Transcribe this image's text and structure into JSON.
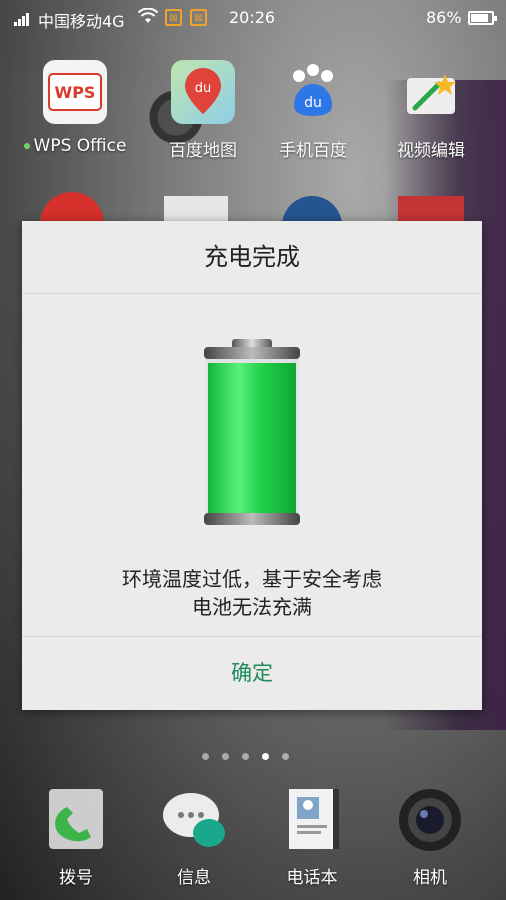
{
  "status_bar": {
    "carrier": "中国移动4G",
    "time": "20:26",
    "battery_percent": "86%",
    "battery_level": 0.86
  },
  "apps": [
    {
      "label": "WPS Office",
      "icon": "wps-office-icon",
      "has_dot": true
    },
    {
      "label": "百度地图",
      "icon": "baidu-map-icon"
    },
    {
      "label": "手机百度",
      "icon": "mobile-baidu-icon"
    },
    {
      "label": "视频编辑",
      "icon": "video-editor-icon"
    }
  ],
  "dialog": {
    "title": "充电完成",
    "message_line1": "环境温度过低，基于安全考虑",
    "message_line2": "电池无法充满",
    "ok_label": "确定",
    "battery_fill_level": 1.0,
    "accent_color": "#1e8a5c",
    "battery_color": "#22d14a"
  },
  "page_indicator": {
    "count": 5,
    "active": 3
  },
  "dock": [
    {
      "label": "拨号",
      "icon": "phone-dialer-icon"
    },
    {
      "label": "信息",
      "icon": "messages-icon"
    },
    {
      "label": "电话本",
      "icon": "contacts-icon"
    },
    {
      "label": "相机",
      "icon": "camera-icon"
    }
  ]
}
